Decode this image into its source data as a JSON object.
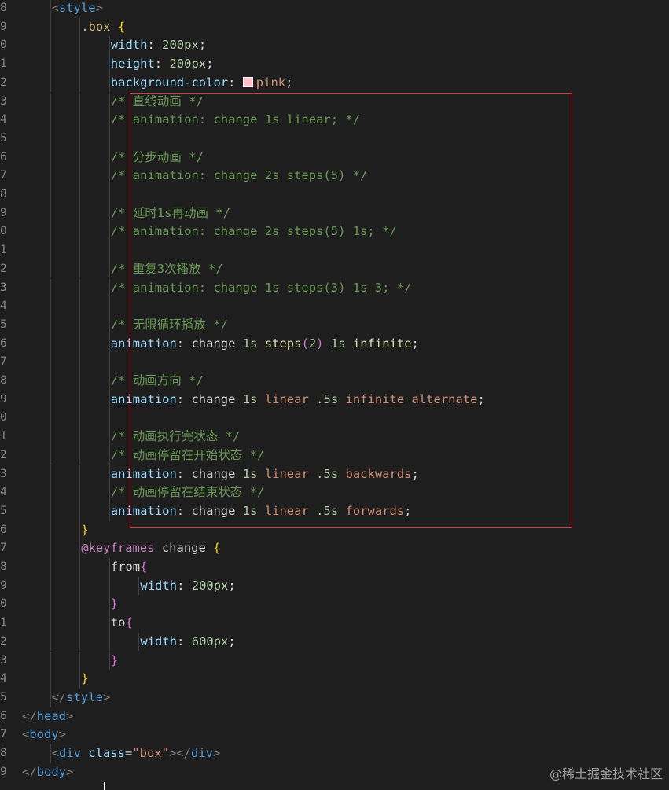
{
  "editor": {
    "lines": [
      {
        "num": "8",
        "indent": 2,
        "tokens": [
          [
            "punct",
            "<"
          ],
          [
            "tag",
            "style"
          ],
          [
            "punct",
            ">"
          ]
        ]
      },
      {
        "num": "9",
        "indent": 3,
        "tokens": [
          [
            "sel",
            ".box"
          ],
          [
            "plain",
            " "
          ],
          [
            "brace1",
            "{"
          ]
        ]
      },
      {
        "num": "0",
        "indent": 4,
        "tokens": [
          [
            "prop",
            "width"
          ],
          [
            "plain",
            ": "
          ],
          [
            "num",
            "200px"
          ],
          [
            "plain",
            ";"
          ]
        ]
      },
      {
        "num": "1",
        "indent": 4,
        "tokens": [
          [
            "prop",
            "height"
          ],
          [
            "plain",
            ": "
          ],
          [
            "num",
            "200px"
          ],
          [
            "plain",
            ";"
          ]
        ]
      },
      {
        "num": "2",
        "indent": 4,
        "tokens": [
          [
            "prop",
            "background-color"
          ],
          [
            "plain",
            ": "
          ],
          [
            "swatch",
            ""
          ],
          [
            "val",
            "pink"
          ],
          [
            "plain",
            ";"
          ]
        ]
      },
      {
        "num": "3",
        "indent": 4,
        "tokens": [
          [
            "com",
            "/* 直线动画 */"
          ]
        ]
      },
      {
        "num": "4",
        "indent": 4,
        "tokens": [
          [
            "com",
            "/* animation: change 1s linear; */"
          ]
        ]
      },
      {
        "num": "5",
        "indent": 4,
        "tokens": []
      },
      {
        "num": "6",
        "indent": 4,
        "tokens": [
          [
            "com",
            "/* 分步动画 */"
          ]
        ]
      },
      {
        "num": "7",
        "indent": 4,
        "tokens": [
          [
            "com",
            "/* animation: change 2s steps(5) */"
          ]
        ]
      },
      {
        "num": "8",
        "indent": 4,
        "tokens": []
      },
      {
        "num": "9",
        "indent": 4,
        "tokens": [
          [
            "com",
            "/* 延时1s再动画 */"
          ]
        ]
      },
      {
        "num": "0",
        "indent": 4,
        "tokens": [
          [
            "com",
            "/* animation: change 2s steps(5) 1s; */"
          ]
        ]
      },
      {
        "num": "1",
        "indent": 4,
        "tokens": []
      },
      {
        "num": "2",
        "indent": 4,
        "tokens": [
          [
            "com",
            "/* 重复3次播放 */"
          ]
        ]
      },
      {
        "num": "3",
        "indent": 4,
        "tokens": [
          [
            "com",
            "/* animation: change 1s steps(3) 1s 3; */"
          ]
        ]
      },
      {
        "num": "4",
        "indent": 4,
        "tokens": []
      },
      {
        "num": "5",
        "indent": 4,
        "tokens": [
          [
            "com",
            "/* 无限循环播放 */"
          ]
        ]
      },
      {
        "num": "6",
        "indent": 4,
        "tokens": [
          [
            "prop",
            "animation"
          ],
          [
            "plain",
            ": change "
          ],
          [
            "num",
            "1s"
          ],
          [
            "plain",
            " "
          ],
          [
            "fn",
            "steps"
          ],
          [
            "brace2",
            "("
          ],
          [
            "num",
            "2"
          ],
          [
            "brace2",
            ")"
          ],
          [
            "plain",
            " "
          ],
          [
            "num",
            "1s"
          ],
          [
            "plain",
            " "
          ],
          [
            "fn",
            "infinite"
          ],
          [
            "plain",
            ";"
          ]
        ]
      },
      {
        "num": "7",
        "indent": 4,
        "tokens": []
      },
      {
        "num": "8",
        "indent": 4,
        "tokens": [
          [
            "com",
            "/* 动画方向 */"
          ]
        ]
      },
      {
        "num": "9",
        "indent": 4,
        "tokens": [
          [
            "prop",
            "animation"
          ],
          [
            "plain",
            ": change "
          ],
          [
            "num",
            "1s"
          ],
          [
            "plain",
            " "
          ],
          [
            "val",
            "linear"
          ],
          [
            "plain",
            " "
          ],
          [
            "num",
            ".5s"
          ],
          [
            "plain",
            " "
          ],
          [
            "val",
            "infinite alternate"
          ],
          [
            "plain",
            ";"
          ]
        ]
      },
      {
        "num": "0",
        "indent": 4,
        "tokens": []
      },
      {
        "num": "1",
        "indent": 4,
        "tokens": [
          [
            "com",
            "/* 动画执行完状态 */"
          ]
        ]
      },
      {
        "num": "2",
        "indent": 4,
        "tokens": [
          [
            "com",
            "/* 动画停留在开始状态 */"
          ]
        ]
      },
      {
        "num": "3",
        "indent": 4,
        "tokens": [
          [
            "prop",
            "animation"
          ],
          [
            "plain",
            ": change "
          ],
          [
            "num",
            "1s"
          ],
          [
            "plain",
            " "
          ],
          [
            "val",
            "linear"
          ],
          [
            "plain",
            " "
          ],
          [
            "num",
            ".5s"
          ],
          [
            "plain",
            " "
          ],
          [
            "val",
            "backwards"
          ],
          [
            "plain",
            ";"
          ]
        ]
      },
      {
        "num": "4",
        "indent": 4,
        "tokens": [
          [
            "com",
            "/* 动画停留在结束状态 */"
          ]
        ]
      },
      {
        "num": "5",
        "indent": 4,
        "tokens": [
          [
            "prop",
            "animation"
          ],
          [
            "plain",
            ": change "
          ],
          [
            "num",
            "1s"
          ],
          [
            "plain",
            " "
          ],
          [
            "val",
            "linear"
          ],
          [
            "plain",
            " "
          ],
          [
            "num",
            ".5s"
          ],
          [
            "plain",
            " "
          ],
          [
            "val",
            "forwards"
          ],
          [
            "plain",
            ";"
          ]
        ]
      },
      {
        "num": "6",
        "indent": 3,
        "tokens": [
          [
            "brace1",
            "}"
          ]
        ]
      },
      {
        "num": "7",
        "indent": 3,
        "tokens": [
          [
            "kw",
            "@keyframes"
          ],
          [
            "plain",
            " change "
          ],
          [
            "brace1",
            "{"
          ]
        ]
      },
      {
        "num": "8",
        "indent": 4,
        "tokens": [
          [
            "plain",
            "from"
          ],
          [
            "brace2",
            "{"
          ]
        ]
      },
      {
        "num": "9",
        "indent": 5,
        "tokens": [
          [
            "prop",
            "width"
          ],
          [
            "plain",
            ": "
          ],
          [
            "num",
            "200px"
          ],
          [
            "plain",
            ";"
          ]
        ]
      },
      {
        "num": "0",
        "indent": 4,
        "tokens": [
          [
            "brace2",
            "}"
          ]
        ]
      },
      {
        "num": "1",
        "indent": 4,
        "tokens": [
          [
            "plain",
            "to"
          ],
          [
            "brace2",
            "{"
          ]
        ]
      },
      {
        "num": "2",
        "indent": 5,
        "tokens": [
          [
            "prop",
            "width"
          ],
          [
            "plain",
            ": "
          ],
          [
            "num",
            "600px"
          ],
          [
            "plain",
            ";"
          ]
        ]
      },
      {
        "num": "3",
        "indent": 4,
        "tokens": [
          [
            "brace2",
            "}"
          ]
        ]
      },
      {
        "num": "4",
        "indent": 3,
        "tokens": [
          [
            "brace1",
            "}"
          ]
        ]
      },
      {
        "num": "5",
        "indent": 2,
        "tokens": [
          [
            "punct",
            "</"
          ],
          [
            "tag",
            "style"
          ],
          [
            "punct",
            ">"
          ]
        ]
      },
      {
        "num": "6",
        "indent": 1,
        "tokens": [
          [
            "punct",
            "</"
          ],
          [
            "tag",
            "head"
          ],
          [
            "punct",
            ">"
          ]
        ]
      },
      {
        "num": "7",
        "indent": 1,
        "tokens": [
          [
            "punct",
            "<"
          ],
          [
            "tag",
            "body"
          ],
          [
            "punct",
            ">"
          ]
        ]
      },
      {
        "num": "8",
        "indent": 2,
        "tokens": [
          [
            "punct",
            "<"
          ],
          [
            "tag",
            "div"
          ],
          [
            "plain",
            " "
          ],
          [
            "attr",
            "class"
          ],
          [
            "plain",
            "="
          ],
          [
            "str",
            "\"box\""
          ],
          [
            "punct",
            "></"
          ],
          [
            "tag",
            "div"
          ],
          [
            "punct",
            ">"
          ]
        ]
      },
      {
        "num": "9",
        "indent": 1,
        "tokens": [
          [
            "punct",
            "</"
          ],
          [
            "tag",
            "body"
          ],
          [
            "punct",
            ">"
          ]
        ]
      }
    ]
  },
  "watermark": "@稀土掘金技术社区",
  "colors": {
    "background": "#1e1e1e",
    "highlight_border": "#e0363b",
    "swatch": "#ffc0cb"
  }
}
